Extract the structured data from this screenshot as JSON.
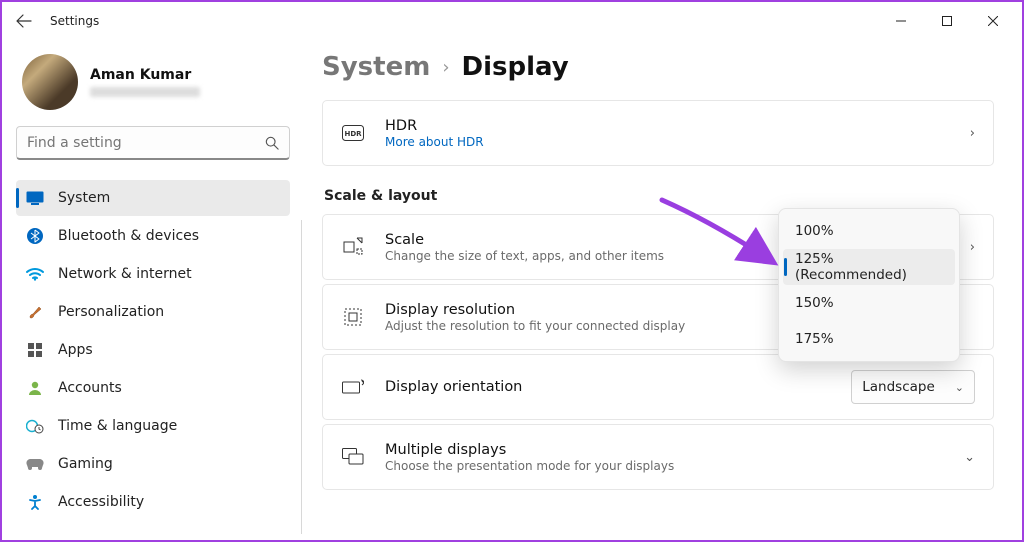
{
  "window": {
    "title": "Settings"
  },
  "profile": {
    "name": "Aman Kumar"
  },
  "search": {
    "placeholder": "Find a setting"
  },
  "nav": {
    "items": [
      {
        "label": "System",
        "icon": "monitor"
      },
      {
        "label": "Bluetooth & devices",
        "icon": "bluetooth"
      },
      {
        "label": "Network & internet",
        "icon": "wifi"
      },
      {
        "label": "Personalization",
        "icon": "brush"
      },
      {
        "label": "Apps",
        "icon": "apps"
      },
      {
        "label": "Accounts",
        "icon": "person"
      },
      {
        "label": "Time & language",
        "icon": "clock-globe"
      },
      {
        "label": "Gaming",
        "icon": "gamepad"
      },
      {
        "label": "Accessibility",
        "icon": "accessibility"
      }
    ],
    "activeIndex": 0
  },
  "breadcrumb": {
    "parent": "System",
    "current": "Display"
  },
  "hdr": {
    "title": "HDR",
    "link": "More about HDR"
  },
  "sectionTitle": "Scale & layout",
  "scale": {
    "title": "Scale",
    "sub": "Change the size of text, apps, and other items",
    "options": [
      "100%",
      "125% (Recommended)",
      "150%",
      "175%"
    ],
    "selectedIndex": 1
  },
  "resolution": {
    "title": "Display resolution",
    "sub": "Adjust the resolution to fit your connected display"
  },
  "orientation": {
    "title": "Display orientation",
    "value": "Landscape"
  },
  "multiple": {
    "title": "Multiple displays",
    "sub": "Choose the presentation mode for your displays"
  }
}
